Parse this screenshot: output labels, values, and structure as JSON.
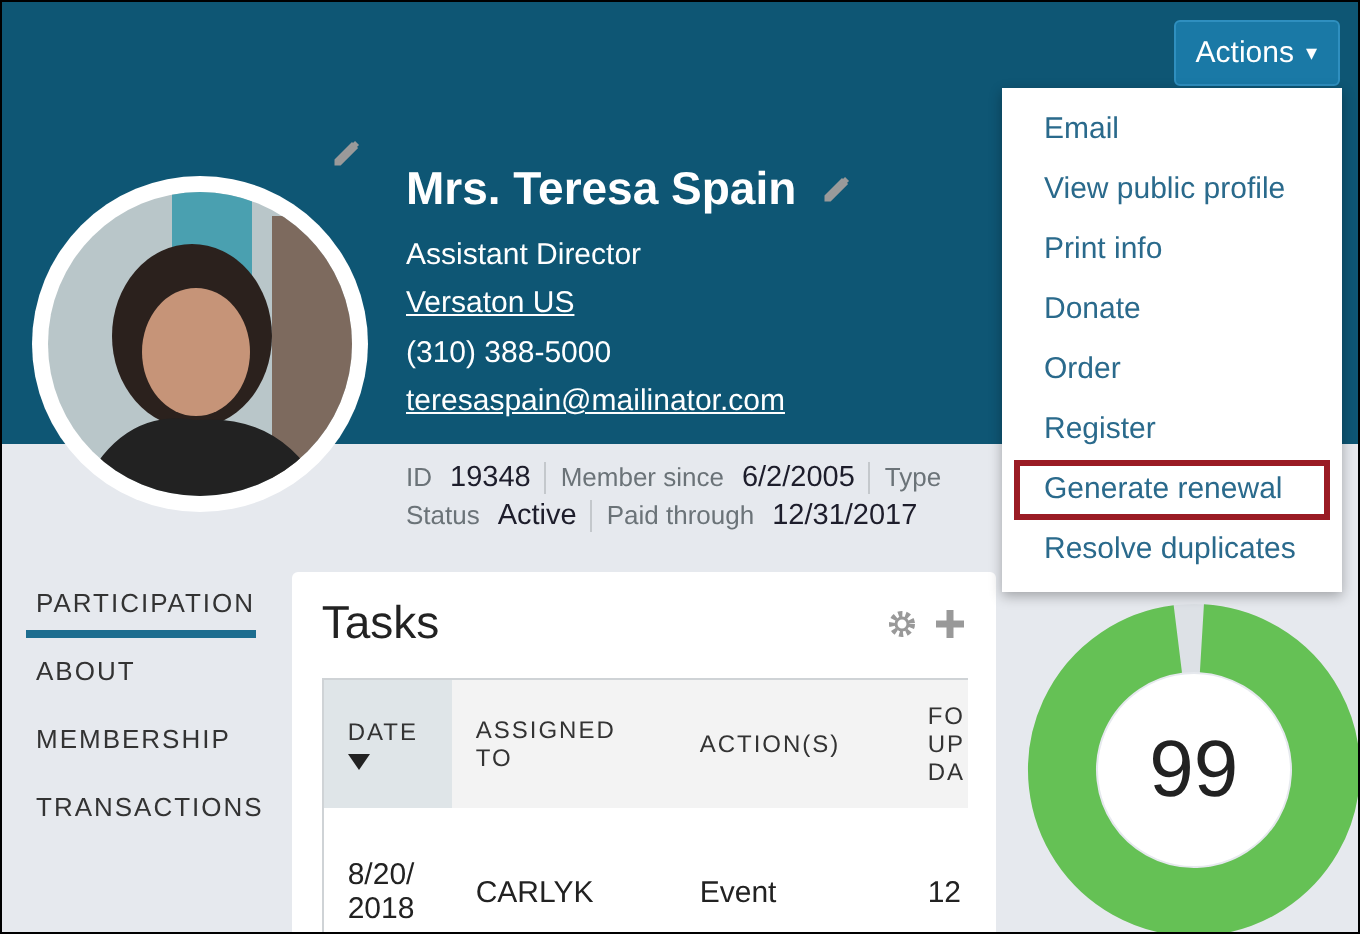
{
  "profile": {
    "name": "Mrs. Teresa Spain",
    "title": "Assistant Director",
    "organization": "Versaton US",
    "phone": "(310) 388-5000",
    "email": "teresaspain@mailinator.com"
  },
  "meta": [
    [
      {
        "label": "ID",
        "value": "19348"
      },
      {
        "label": "Member since",
        "value": "6/2/2005"
      },
      {
        "label": "Type"
      }
    ],
    [
      {
        "label": "Status",
        "value": "Active"
      },
      {
        "label": "Paid through",
        "value": "12/31/2017"
      }
    ]
  ],
  "actions": {
    "label": "Actions",
    "caret": "▾",
    "menu": [
      {
        "label": "Email",
        "selected": false
      },
      {
        "label": "View public profile",
        "selected": false
      },
      {
        "label": "Print info",
        "selected": false
      },
      {
        "label": "Donate",
        "selected": false
      },
      {
        "label": "Order",
        "selected": false
      },
      {
        "label": "Register",
        "selected": false
      },
      {
        "label": "Generate renewal",
        "selected": true
      },
      {
        "label": "Resolve duplicates",
        "selected": false
      }
    ]
  },
  "nav": [
    {
      "label": "PARTICIPATION",
      "selected": true
    },
    {
      "label": "ABOUT",
      "selected": false
    },
    {
      "label": "MEMBERSHIP",
      "selected": false
    },
    {
      "label": "TRANSACTIONS",
      "selected": false
    }
  ],
  "tasks": {
    "title": "Tasks",
    "columns": [
      {
        "label": "DATE",
        "sorted": true
      },
      {
        "label": "ASSIGNED TO",
        "sorted": false
      },
      {
        "label": "ACTION(S)",
        "sorted": false
      },
      {
        "label": "FO UP DA",
        "sorted": false
      }
    ],
    "rows": [
      [
        "8/20/ 2018",
        "CARLYK",
        "Event",
        "12"
      ]
    ]
  },
  "score": {
    "value": "99",
    "level": 0.99
  }
}
